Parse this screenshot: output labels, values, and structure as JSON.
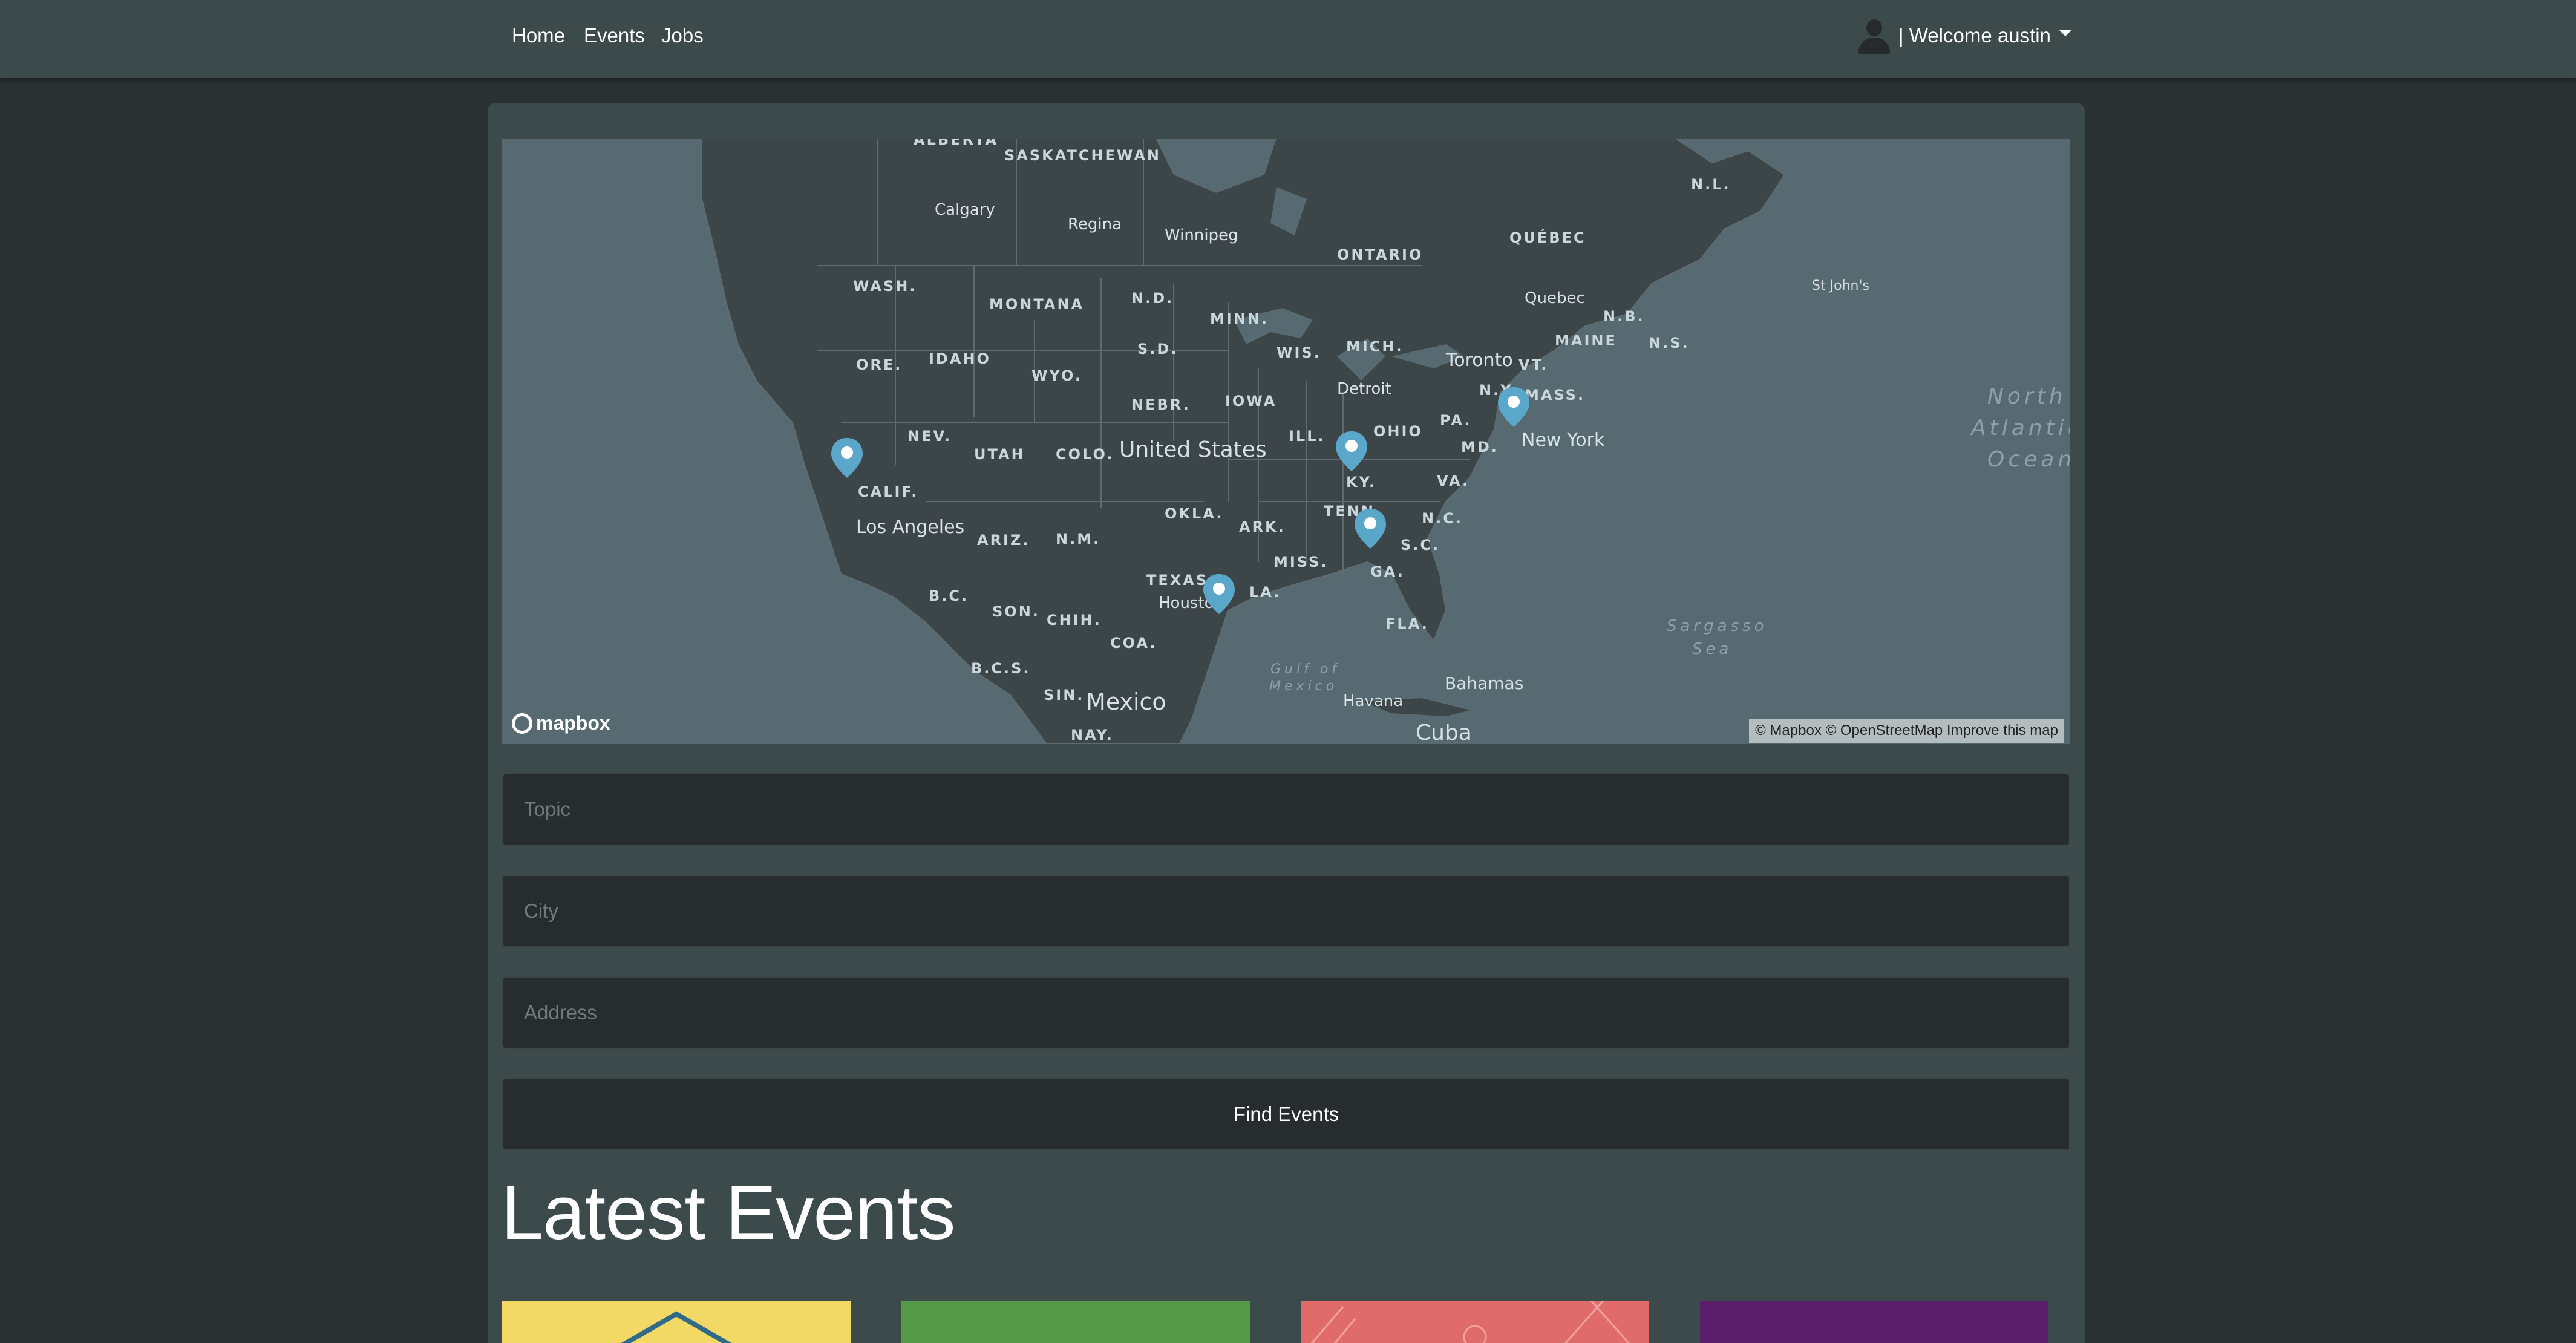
{
  "nav": {
    "links": [
      "Home",
      "Events",
      "Jobs"
    ],
    "user_greeting": "| Welcome austin"
  },
  "map": {
    "attribution": "© Mapbox © OpenStreetMap Improve this map",
    "logo_text": "mapbox",
    "labels": {
      "regions": [
        "ALBERTA",
        "SASKATCHEWAN",
        "WASH.",
        "MONTANA",
        "N.D.",
        "MINN.",
        "ONTARIO",
        "QUÉBEC",
        "N.L.",
        "ORE.",
        "IDAHO",
        "WYO.",
        "S.D.",
        "WIS.",
        "MICH.",
        "MAINE",
        "N.B.",
        "N.S.",
        "NEBR.",
        "IOWA",
        "NEV.",
        "UTAH",
        "COLO.",
        "ILL.",
        "OHIO",
        "PA.",
        "N.Y.",
        "VT.",
        "MASS.",
        "MD.",
        "CALIF.",
        "KY.",
        "VA.",
        "OKLA.",
        "ARK.",
        "TENN.",
        "N.C.",
        "ARIZ.",
        "N.M.",
        "S.C.",
        "MISS.",
        "GA.",
        "TEXAS",
        "LA.",
        "B.C.",
        "SON.",
        "CHIH.",
        "COA.",
        "FLA.",
        "B.C.S.",
        "SIN.",
        "NAY."
      ],
      "cities": [
        "Calgary",
        "Regina",
        "Winnipeg",
        "Quebec",
        "St John's",
        "Toronto",
        "Detroit",
        "New York",
        "Los Angeles",
        "Houston",
        "Havana",
        "Bahamas",
        "Cuba",
        "Mexico",
        "United States"
      ],
      "waters": [
        "North",
        "Atlantic",
        "Ocean",
        "Sargasso",
        "Sea",
        "Gulf of",
        "Mexico"
      ]
    },
    "markers": [
      "Los Angeles",
      "Chicago area",
      "Atlanta",
      "Houston",
      "New York"
    ]
  },
  "search": {
    "topic_placeholder": "Topic",
    "city_placeholder": "City",
    "address_placeholder": "Address",
    "find_label": "Find Events"
  },
  "latest": {
    "title": "Latest Events",
    "cards": [
      {
        "color": "#f2d864"
      },
      {
        "color": "#559a48"
      },
      {
        "color": "#e06b6b"
      },
      {
        "color": "#5a1f68"
      }
    ]
  }
}
